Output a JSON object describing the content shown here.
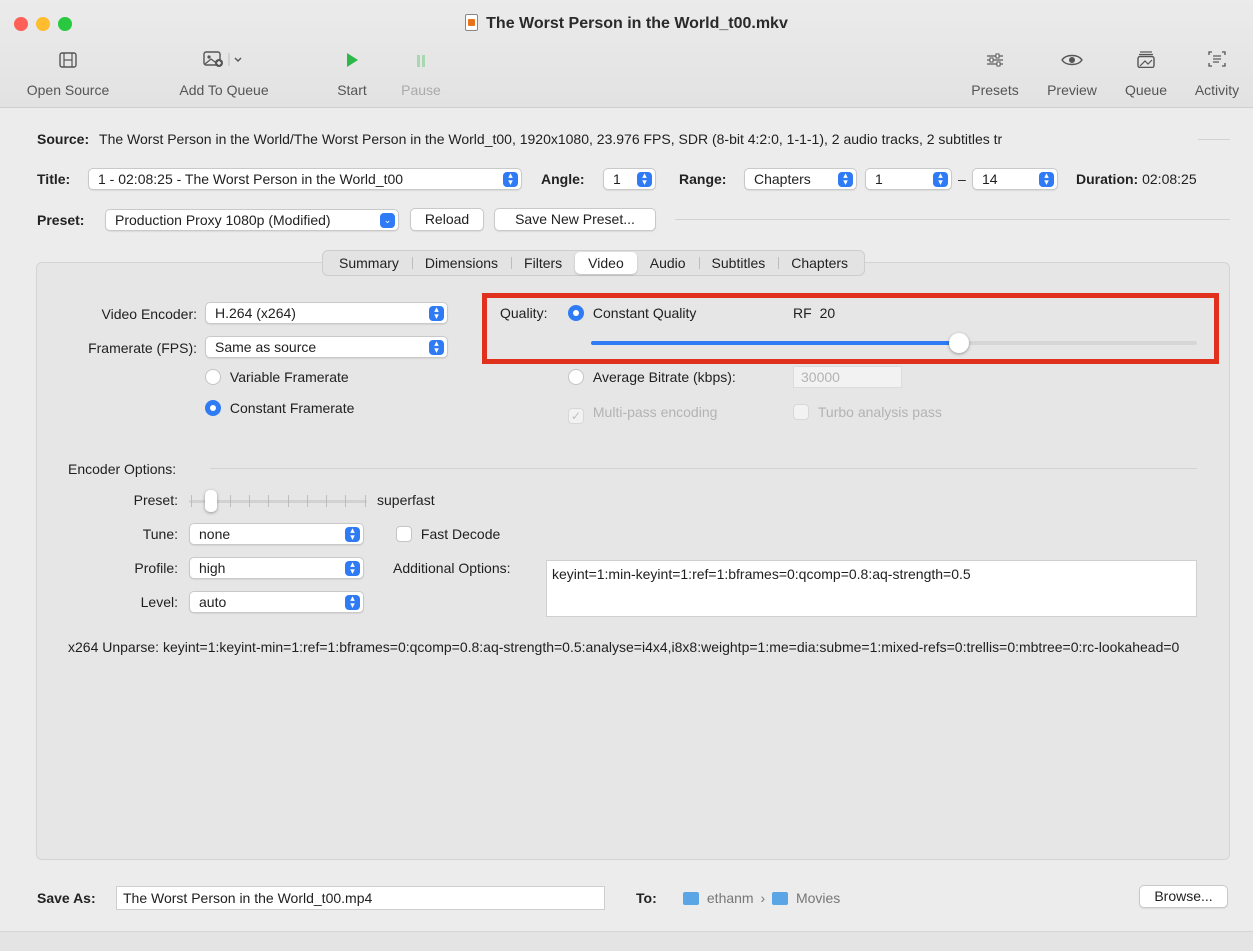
{
  "window": {
    "title": "The Worst Person in the World_t00.mkv",
    "traffic_lights": [
      "#fe5f57",
      "#febc2e",
      "#28c840"
    ]
  },
  "toolbar": {
    "open_source": "Open Source",
    "add_to_queue": "Add To Queue",
    "start": "Start",
    "pause": "Pause",
    "presets": "Presets",
    "preview": "Preview",
    "queue": "Queue",
    "activity": "Activity"
  },
  "source": {
    "label": "Source:",
    "value": "The Worst Person in the World/The Worst Person in the World_t00, 1920x1080, 23.976 FPS, SDR (8-bit 4:2:0, 1-1-1), 2 audio tracks, 2 subtitles tr"
  },
  "title_row": {
    "title_label": "Title:",
    "title_value": "1 - 02:08:25 - The Worst Person in the World_t00",
    "angle_label": "Angle:",
    "angle_value": "1",
    "range_label": "Range:",
    "range_type": "Chapters",
    "range_start": "1",
    "range_dash": "–",
    "range_end": "14",
    "duration_label": "Duration:",
    "duration_value": "02:08:25"
  },
  "preset_row": {
    "label": "Preset:",
    "value": "Production Proxy 1080p (Modified)",
    "reload": "Reload",
    "save_new": "Save New Preset..."
  },
  "tabs": [
    "Summary",
    "Dimensions",
    "Filters",
    "Video",
    "Audio",
    "Subtitles",
    "Chapters"
  ],
  "selected_tab": "Video",
  "video": {
    "encoder_label": "Video Encoder:",
    "encoder_value": "H.264 (x264)",
    "framerate_label": "Framerate (FPS):",
    "framerate_value": "Same as source",
    "variable_framerate": "Variable Framerate",
    "constant_framerate": "Constant Framerate",
    "quality_label": "Quality:",
    "constant_quality": "Constant Quality",
    "rf_label": "RF",
    "rf_value": "20",
    "quality_slider_fraction": 0.607,
    "average_bitrate": "Average Bitrate (kbps):",
    "bitrate_value": "30000",
    "multipass": "Multi-pass encoding",
    "turbo": "Turbo analysis pass"
  },
  "encoder_options": {
    "header": "Encoder Options:",
    "preset_label": "Preset:",
    "preset_value": "superfast",
    "tune_label": "Tune:",
    "tune_value": "none",
    "fast_decode": "Fast Decode",
    "profile_label": "Profile:",
    "profile_value": "high",
    "additional_label": "Additional Options:",
    "additional_value": "keyint=1:min-keyint=1:ref=1:bframes=0:qcomp=0.8:aq-strength=0.5",
    "level_label": "Level:",
    "level_value": "auto",
    "unparse": "x264 Unparse: keyint=1:keyint-min=1:ref=1:bframes=0:qcomp=0.8:aq-strength=0.5:analyse=i4x4,i8x8:weightp=1:me=dia:subme=1:mixed-refs=0:trellis=0:mbtree=0:rc-lookahead=0"
  },
  "save": {
    "label": "Save As:",
    "value": "The Worst Person in the World_t00.mp4",
    "to_label": "To:",
    "path_user": "ethanm",
    "path_sep": "›",
    "path_folder": "Movies",
    "browse": "Browse..."
  },
  "colors": {
    "accent": "#2f7bf6",
    "highlight_box": "#e0301e",
    "start_green": "#2db84a"
  }
}
